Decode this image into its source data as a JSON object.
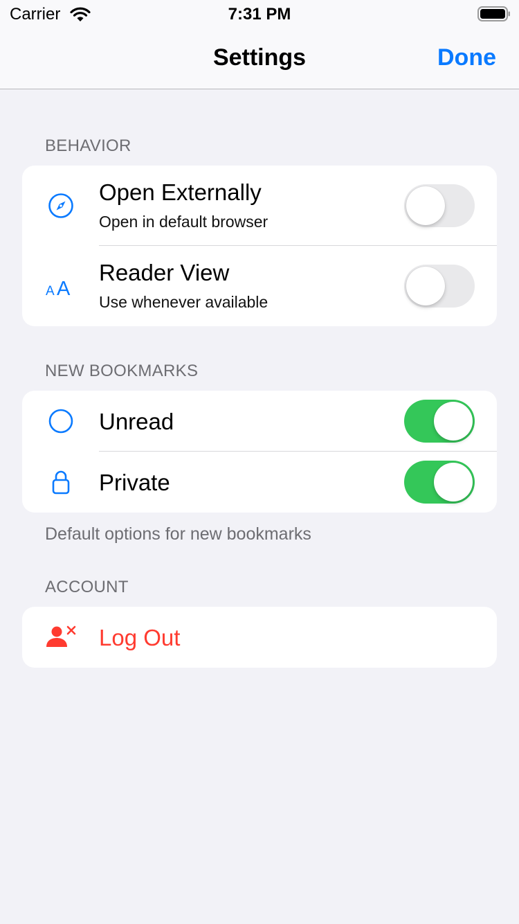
{
  "status_bar": {
    "carrier": "Carrier",
    "time": "7:31 PM"
  },
  "nav": {
    "title": "Settings",
    "done_label": "Done"
  },
  "colors": {
    "accent": "#0a7aff",
    "toggle_on": "#34c759",
    "destructive": "#ff3b30"
  },
  "behavior": {
    "header": "BEHAVIOR",
    "items": [
      {
        "icon": "compass-icon",
        "title": "Open Externally",
        "subtitle": "Open in default browser",
        "enabled": false
      },
      {
        "icon": "text-size-icon",
        "title": "Reader View",
        "subtitle": "Use whenever available",
        "enabled": false
      }
    ]
  },
  "new_bookmarks": {
    "header": "NEW BOOKMARKS",
    "footer": "Default options for new bookmarks",
    "items": [
      {
        "icon": "circle-icon",
        "title": "Unread",
        "enabled": true
      },
      {
        "icon": "lock-icon",
        "title": "Private",
        "enabled": true
      }
    ]
  },
  "account": {
    "header": "ACCOUNT",
    "items": [
      {
        "icon": "person-remove-icon",
        "title": "Log Out"
      }
    ]
  }
}
